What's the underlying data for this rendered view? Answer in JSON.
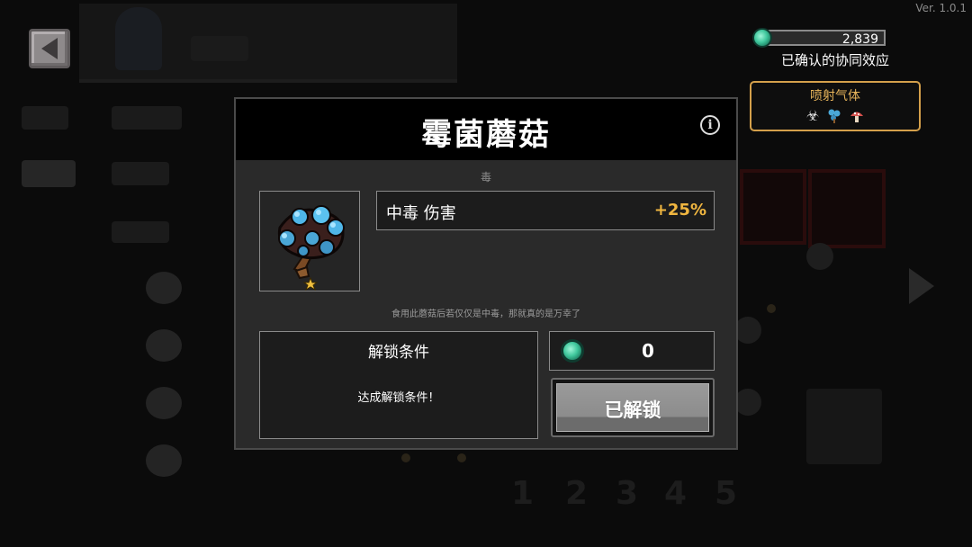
{
  "app": {
    "version": "Ver. 1.0.1"
  },
  "top_right": {
    "currency_value": "2,839",
    "synergy_label": "已确认的协同效应",
    "synergy_box_title": "喷射气体",
    "synergy_icons": [
      "biohazard-icon",
      "blue-mushroom-icon",
      "red-mushroom-icon"
    ]
  },
  "modal": {
    "title": "霉菌蘑菇",
    "category": "毒",
    "stat_name": "中毒 伤害",
    "stat_value": "+25%",
    "flavor_text": "食用此蘑菇后若仅仅是中毒，那就真的是万幸了",
    "unlock_title": "解锁条件",
    "unlock_description": "达成解锁条件！",
    "cost": "0",
    "unlocked_button_label": "已解锁"
  },
  "colors": {
    "accent_gold": "#f0b640",
    "synergy_border": "#d4a04b",
    "gem": "#3fc79c"
  }
}
